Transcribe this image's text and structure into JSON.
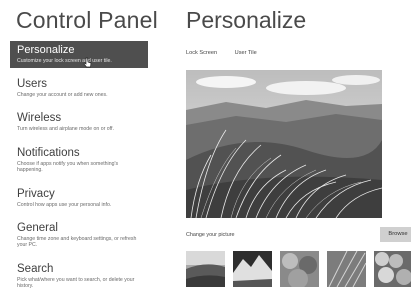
{
  "control_panel": {
    "title": "Control Panel"
  },
  "page": {
    "title": "Personalize"
  },
  "nav": {
    "items": [
      {
        "label": "Personalize",
        "desc": "Customize your lock screen and user tile."
      },
      {
        "label": "Users",
        "desc": "Change your account or add new ones."
      },
      {
        "label": "Wireless",
        "desc": "Turn wireless and airplane mode on or off."
      },
      {
        "label": "Notifications",
        "desc": "Choose if apps notify you when something's happening."
      },
      {
        "label": "Privacy",
        "desc": "Control how apps use your personal info."
      },
      {
        "label": "General",
        "desc": "Change time zone and keyboard settings, or refresh your PC."
      },
      {
        "label": "Search",
        "desc": "Pick what/where you want to search, or delete your history."
      }
    ]
  },
  "tabs": {
    "lock_screen": "Lock Screen",
    "user_tile": "User Tile"
  },
  "picture": {
    "change_label": "Change your picture",
    "browse_label": "Browse"
  },
  "icons": {
    "cursor": "cursor-icon"
  },
  "colors": {
    "selected_bg": "#4f4f4f",
    "browse_bg": "#d0d0d0",
    "text": "#3a3a3a"
  }
}
